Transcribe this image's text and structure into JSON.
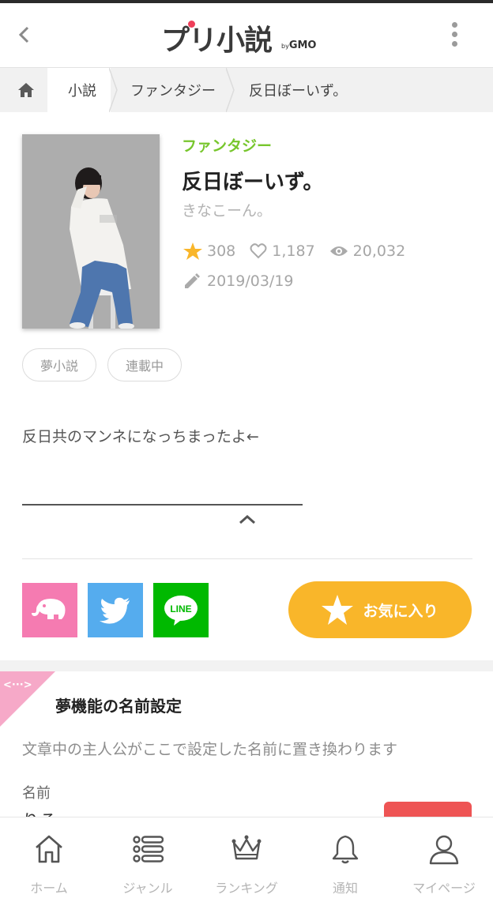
{
  "header": {
    "logo_main": "プリ小説",
    "logo_by": "by",
    "logo_brand": "GMO"
  },
  "breadcrumb": {
    "items": [
      "小説",
      "ファンタジー",
      "反日ぼーいず。"
    ]
  },
  "book": {
    "genre": "ファンタジー",
    "title": "反日ぼーいず。",
    "author": "きなこーん。",
    "stars": "308",
    "likes": "1,187",
    "views": "20,032",
    "date": "2019/03/19",
    "tags": [
      "夢小説",
      "連載中"
    ],
    "synopsis": "反日共のマンネになっちまったよ←"
  },
  "actions": {
    "favorite_label": "お気に入り",
    "line_label": "LINE"
  },
  "dream": {
    "corner_label": "<···>",
    "heading": "夢機能の名前設定",
    "description": "文章中の主人公がここで設定した名前に置き換わります",
    "name_label": "名前",
    "name_value": "りる"
  },
  "bottom_nav": {
    "items": [
      "ホーム",
      "ジャンル",
      "ランキング",
      "通知",
      "マイページ"
    ]
  },
  "colors": {
    "genre": "#77c62c",
    "favorite": "#f9b62a",
    "elephant": "#f57bb1",
    "twitter": "#55acee",
    "line": "#00b900",
    "accent_red": "#ee5454"
  }
}
